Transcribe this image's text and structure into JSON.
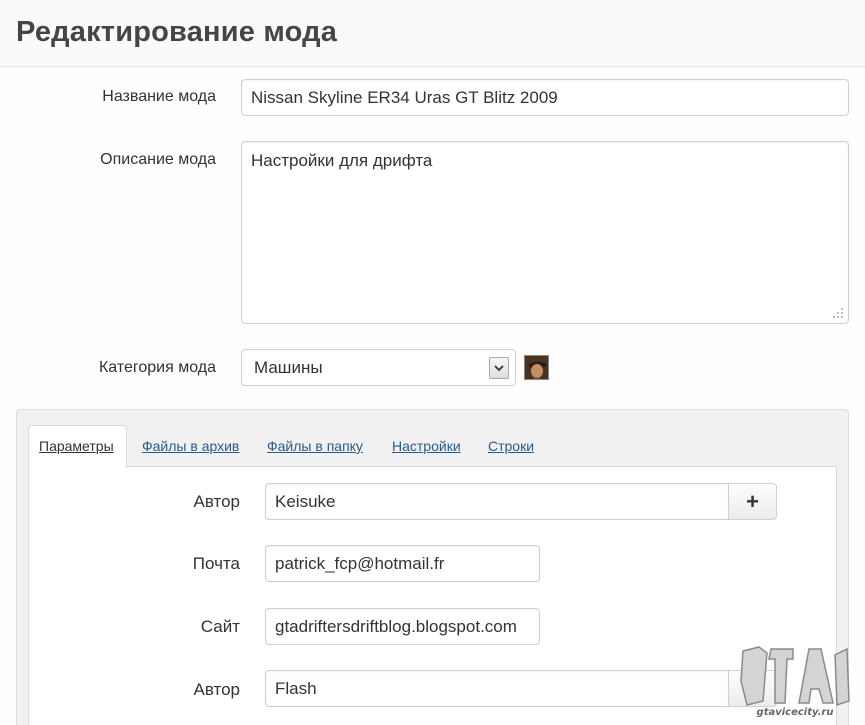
{
  "header": {
    "title": "Редактирование мода"
  },
  "form": {
    "name_label": "Название мода",
    "name_value": "Nissan Skyline ER34 Uras GT Blitz 2009",
    "description_label": "Описание мода",
    "description_value": "Настройки для дрифта",
    "category_label": "Категория мода",
    "category_value": "Машины"
  },
  "tabs": [
    {
      "label": "Параметры",
      "active": true
    },
    {
      "label": "Файлы в архив"
    },
    {
      "label": "Файлы в папку"
    },
    {
      "label": "Настройки"
    },
    {
      "label": "Строки"
    }
  ],
  "params": {
    "author_label": "Автор",
    "author_value": "Keisuke",
    "email_label": "Почта",
    "email_value": "patrick_fcp@hotmail.fr",
    "site_label": "Сайт",
    "site_value": "gtadriftersdriftblog.blogspot.com",
    "author2_label": "Автор",
    "author2_value": "Flash",
    "add_button": "+",
    "remove_button": "×"
  },
  "watermark": {
    "text": "gtavicecity.ru"
  },
  "icons": {
    "category_preview": "avatar-icon",
    "resize": "resize-grip-icon",
    "dropdown": "chevron-down-icon"
  }
}
